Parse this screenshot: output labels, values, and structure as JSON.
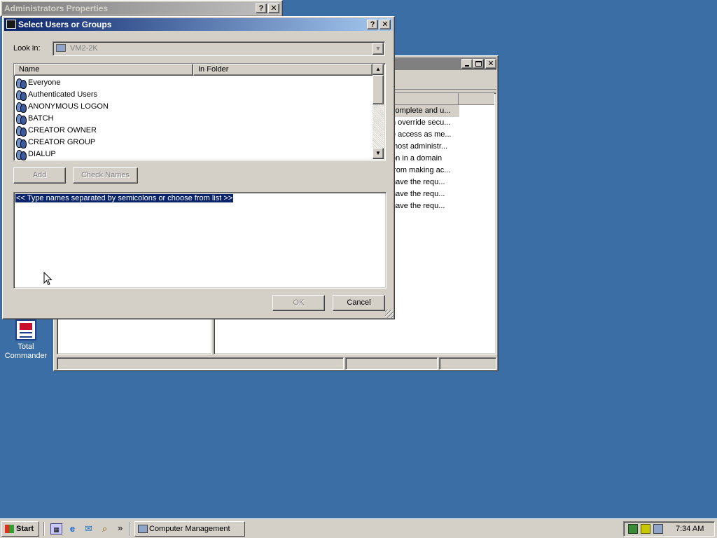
{
  "desktop": {
    "total_commander_label_1": "Total",
    "total_commander_label_2": "Commander"
  },
  "bg_window": {
    "title": "Administrators Properties",
    "help_btn": "?",
    "close_btn": "✕"
  },
  "mgmt_window": {
    "descriptions": [
      "complete and u...",
      "n override secu...",
      "e access as me...",
      "most administr...",
      "on in a domain",
      "from making ac...",
      "have the requ...",
      "have the requ...",
      "have the requ..."
    ]
  },
  "dialog": {
    "title": "Select Users or Groups",
    "help_btn": "?",
    "close_btn": "✕",
    "look_in_label": "Look in:",
    "look_in_value": "VM2-2K",
    "columns": [
      "Name",
      "In Folder"
    ],
    "items": [
      "Everyone",
      "Authenticated Users",
      "ANONYMOUS LOGON",
      "BATCH",
      "CREATOR OWNER",
      "CREATOR GROUP",
      "DIALUP"
    ],
    "add_label": "Add",
    "check_names_label": "Check Names",
    "names_text": "<< Type names separated by semicolons or choose from list >>",
    "ok_label": "OK",
    "cancel_label": "Cancel"
  },
  "taskbar": {
    "start_label": "Start",
    "chevron": "»",
    "task_label": "Computer Management",
    "clock": "7:34 AM"
  },
  "colors": {
    "desktop": "#3a6ea5",
    "title_active": "#0a246a",
    "selection": "#0a246a"
  }
}
